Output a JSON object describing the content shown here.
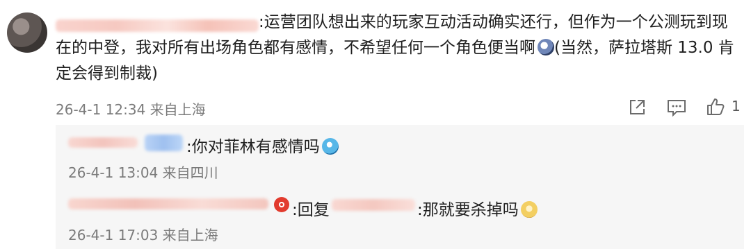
{
  "comment": {
    "text_line1": ":运营团队想出来的玩家互动活动确实还行，但作为一个公测玩到现",
    "text_line2": "在的中登，我对所有出场角色都有感情，不希望任何一个角色便当啊",
    "text_line2b": "(当然，萨拉塔斯 13.0 肯",
    "text_line3": "定会得到制裁)",
    "time": "26-4-1 12:34 来自上海",
    "like_count": "1"
  },
  "replies": [
    {
      "text": ":你对菲林有感情吗",
      "time": "26-4-1 13:04 来自四川"
    },
    {
      "reply_label": ":回复",
      "text": ":那就要杀掉吗",
      "time": "26-4-1 17:03 来自上海"
    }
  ],
  "colors": {
    "text": "#1f1f1f",
    "meta": "#7b7b7b",
    "reply_bg": "#f6f6f6",
    "blur_pink": "#f8d4cf",
    "blur_blue": "#a9c9f2"
  },
  "icons": [
    "share-icon",
    "comment-icon",
    "like-icon"
  ]
}
